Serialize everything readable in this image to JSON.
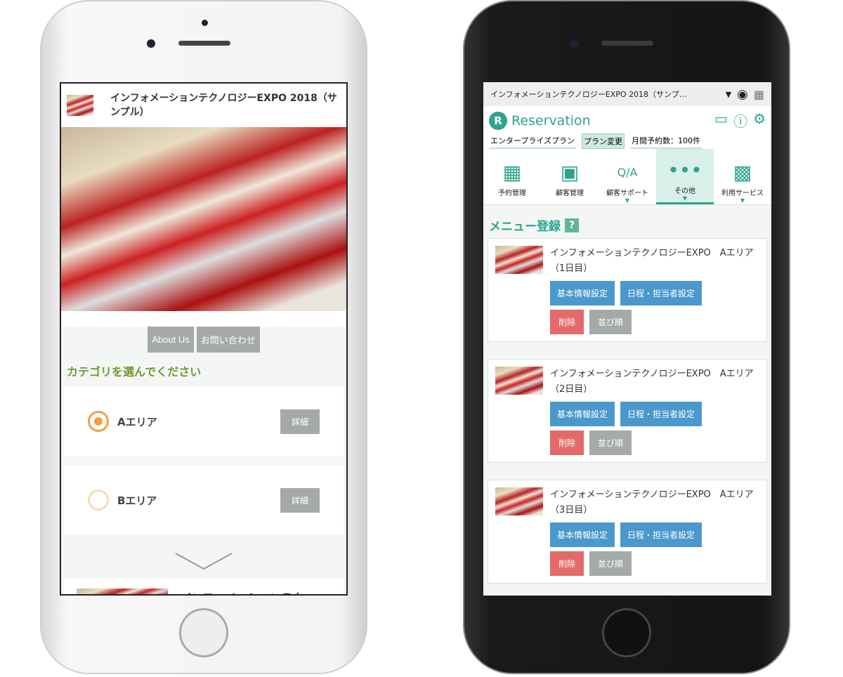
{
  "left_phone": {
    "header_title": "インフォメーションテクノロジーEXPO 2018（サンプル）",
    "buttons": [
      "About Us",
      "お問い合わせ"
    ],
    "category_title": "カテゴリを選んでください",
    "categories": [
      {
        "label": "Aエリア",
        "selected": true,
        "detail": "詳細"
      },
      {
        "label": "Bエリア",
        "selected": false,
        "detail": "詳細"
      }
    ],
    "next_item_title": "インフォメーションテク"
  },
  "right_phone": {
    "topbar_title": "インフォメーションテクノロジーEXPO 2018（サンプ…",
    "app_name": "Reservation",
    "logo_letter": "R",
    "plan": "エンタープライズプラン",
    "plan_change": "プラン変更",
    "monthly": "月間予約数：100件",
    "nav": [
      {
        "label": "予約管理",
        "icon": "calendar-icon"
      },
      {
        "label": "顧客管理",
        "icon": "customer-icon"
      },
      {
        "label": "顧客サポート",
        "icon": "qa-icon"
      },
      {
        "label": "その他",
        "icon": "more-icon",
        "active": true
      },
      {
        "label": "利用サービス",
        "icon": "grid-icon"
      }
    ],
    "section_title": "メニュー登録",
    "help": "?",
    "cards": [
      {
        "title": "インフォメーションテクノロジーEXPO　Aエリア　　（1日目）"
      },
      {
        "title": "インフォメーションテクノロジーEXPO　Aエリア　　（2日目）"
      },
      {
        "title": "インフォメーションテクノロジーEXPO　Aエリア　　（3日目）"
      }
    ],
    "card_buttons": {
      "basic": "基本情報設定",
      "schedule": "日程・担当者設定",
      "delete": "削除",
      "order": "並び順"
    },
    "accent": "#2da48d"
  }
}
